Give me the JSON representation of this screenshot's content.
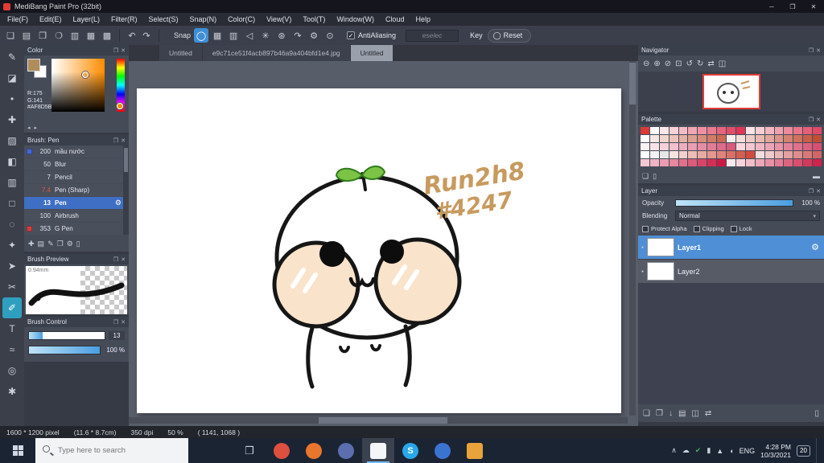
{
  "window": {
    "title": "MediBang Paint Pro (32bit)",
    "controls": {
      "minimize": "─",
      "maximize": "❐",
      "close": "✕"
    }
  },
  "menu_bar": [
    "File(F)",
    "Edit(E)",
    "Layer(L)",
    "Filter(R)",
    "Select(S)",
    "Snap(N)",
    "Color(C)",
    "View(V)",
    "Tool(T)",
    "Window(W)",
    "Cloud",
    "Help"
  ],
  "toolbar": {
    "file_icons": [
      {
        "name": "new-canvas-icon",
        "glyph": "❏"
      },
      {
        "name": "open-file-icon",
        "glyph": "▤"
      },
      {
        "name": "save-icon",
        "glyph": "❐"
      },
      {
        "name": "comment-icon",
        "glyph": "❍"
      },
      {
        "name": "document-icon",
        "glyph": "▥"
      },
      {
        "name": "table-icon",
        "glyph": "▦"
      },
      {
        "name": "grid-icon",
        "glyph": "▩"
      }
    ],
    "undo": {
      "name": "undo-icon",
      "glyph": "↶"
    },
    "redo": {
      "name": "redo-icon",
      "glyph": "↷"
    },
    "snap_label": "Snap",
    "snap_icons": [
      {
        "name": "snap-off-icon",
        "glyph": "◯",
        "active": true
      },
      {
        "name": "snap-grid-icon",
        "glyph": "▦"
      },
      {
        "name": "snap-parallel-icon",
        "glyph": "▥"
      },
      {
        "name": "snap-cross-icon",
        "glyph": "◁"
      },
      {
        "name": "snap-vanishing-point-icon",
        "glyph": "✳"
      },
      {
        "name": "snap-radial-icon",
        "glyph": "⊛"
      },
      {
        "name": "snap-curve-icon",
        "glyph": "↷"
      },
      {
        "name": "snap-settings-icon",
        "glyph": "⚙"
      },
      {
        "name": "snap-detail-settings-icon",
        "glyph": "⊙"
      }
    ],
    "antialiasing_label": "AntiAliasing",
    "combo_text": "eselec",
    "key_label": "Key",
    "reset": {
      "label": "Reset",
      "glyph": "◯"
    }
  },
  "tabs": [
    {
      "label": "Untitled"
    },
    {
      "label": "e9c71ce51f4acb897b46a9a404bfd1e4.jpg"
    },
    {
      "label": "Untitled",
      "active": true
    }
  ],
  "left_tools": [
    {
      "name": "brush-tool",
      "glyph": "✎"
    },
    {
      "name": "eraser-tool",
      "glyph": "◪"
    },
    {
      "name": "dot-tool",
      "glyph": "•"
    },
    {
      "name": "move-tool",
      "glyph": "✚"
    },
    {
      "name": "fill-tool",
      "glyph": "▨"
    },
    {
      "name": "bucket-tool",
      "glyph": "◧"
    },
    {
      "name": "gradient-tool",
      "glyph": "▥"
    },
    {
      "name": "select-tool",
      "glyph": "□"
    },
    {
      "name": "lasso-tool",
      "glyph": "◌"
    },
    {
      "name": "magic-wand-tool",
      "glyph": "✦"
    },
    {
      "name": "operation-tool",
      "glyph": "➤"
    },
    {
      "name": "divide-tool",
      "glyph": "✂"
    },
    {
      "name": "select-pen-tool",
      "glyph": "✐",
      "active": true
    },
    {
      "name": "text-tool",
      "glyph": "T"
    },
    {
      "name": "curve-tool",
      "glyph": "≈"
    },
    {
      "name": "eyedropper-tool",
      "glyph": "◎"
    },
    {
      "name": "hand-tool",
      "glyph": "✱"
    }
  ],
  "panel_icons": {
    "float": "❐",
    "close": "✕"
  },
  "color_panel": {
    "title": "Color",
    "r": "R:175",
    "g": "G:141",
    "hex": "#AF8D5B"
  },
  "brush_panel": {
    "title": "Brush: Pen",
    "items": [
      {
        "size": "200",
        "name": "mầu nước",
        "swatch": "#4668d8"
      },
      {
        "size": "50",
        "name": "Blur"
      },
      {
        "size": "7",
        "name": "Pencil"
      },
      {
        "size": "7.4",
        "name": "Pen (Sharp)",
        "size_color": "#e05a3a"
      },
      {
        "size": "13",
        "name": "Pen",
        "selected": true
      },
      {
        "size": "100",
        "name": "Airbrush"
      },
      {
        "size": "353",
        "name": "G Pen",
        "swatch": "#d04040"
      }
    ],
    "tool_icons": [
      {
        "name": "add-brush-icon",
        "glyph": "✚"
      },
      {
        "name": "brush-folder-icon",
        "glyph": "▤"
      },
      {
        "name": "edit-brush-icon",
        "glyph": "✎"
      },
      {
        "name": "duplicate-brush-icon",
        "glyph": "❐"
      },
      {
        "name": "brush-menu-icon",
        "glyph": "⚙"
      },
      {
        "name": "delete-brush-icon",
        "glyph": "▯"
      }
    ]
  },
  "brush_preview": {
    "title": "Brush Preview",
    "size_label": "0.94mm"
  },
  "brush_control": {
    "title": "Brush Control",
    "size_value": "13",
    "opacity_value": "100 %"
  },
  "canvas": {
    "annotation_line1": "Run2h8",
    "annotation_line2": "#4247"
  },
  "navigator": {
    "title": "Navigator",
    "icons": [
      {
        "name": "zoom-out-icon",
        "glyph": "⊖"
      },
      {
        "name": "zoom-in-icon",
        "glyph": "⊕"
      },
      {
        "name": "zoom-reset-icon",
        "glyph": "⊘"
      },
      {
        "name": "fit-window-icon",
        "glyph": "⊡"
      },
      {
        "name": "rotate-left-icon",
        "glyph": "↺"
      },
      {
        "name": "rotate-right-icon",
        "glyph": "↻"
      },
      {
        "name": "reset-rotation-icon",
        "glyph": "⇄"
      },
      {
        "name": "spread-view-icon",
        "glyph": "◫"
      }
    ]
  },
  "palette": {
    "title": "Palette",
    "colors": [
      [
        "#d93a35",
        "#ffffff",
        "#fce8ea",
        "#f9d2d8",
        "#f5bcc5",
        "#f1a6b3",
        "#ee90a1",
        "#ea7a8e",
        "#e6647c",
        "#e24e69",
        "#de3857",
        "#fbe3e6",
        "#f8cdd3",
        "#f4b7c1",
        "#f0a1ae",
        "#ec8b9c",
        "#e97589",
        "#e55f77",
        "#e14964"
      ],
      [
        "#ffffff",
        "#f6e7e3",
        "#f0d5ce",
        "#eac3ba",
        "#e4b1a5",
        "#dd9f91",
        "#d78d7c",
        "#d17b68",
        "#cb6953",
        "#f9efee",
        "#f3ddd9",
        "#edcbc5",
        "#e7b9b0",
        "#e1a79c",
        "#da9587",
        "#d48373",
        "#ce715e",
        "#c85f4a",
        "#c24d35"
      ],
      [
        "#fdf3f5",
        "#f9e2e8",
        "#f5d1da",
        "#f1c0cd",
        "#edafbf",
        "#e99eb2",
        "#e58da4",
        "#e17c97",
        "#dd6b89",
        "#d95a7c",
        "#f7d8de",
        "#f3c7d1",
        "#efb6c3",
        "#eba5b6",
        "#e794a8",
        "#e3839b",
        "#df728d",
        "#db6180",
        "#d75072"
      ],
      [
        "#ffffff",
        "#f2f2f2",
        "#e6e6e6",
        "#f8e3e1",
        "#f3d0cd",
        "#eebdb8",
        "#e9aaa4",
        "#e49790",
        "#df847b",
        "#da7167",
        "#d55e52",
        "#d04b3e",
        "#f6dddd",
        "#f0c9c9",
        "#eab5b5",
        "#e4a1a1",
        "#de8d8d",
        "#d87979",
        "#d26565"
      ],
      [
        "#f4c9d4",
        "#efb3c2",
        "#ea9db0",
        "#e5879e",
        "#e0718c",
        "#db5b7a",
        "#d64568",
        "#d12f56",
        "#cc1944",
        "#fbe9ed",
        "#f6d3db",
        "#f1bdc9",
        "#eca7b7",
        "#e791a5",
        "#e27b93",
        "#dd6581",
        "#d84f6f",
        "#d3395d",
        "#ce234b"
      ]
    ],
    "icons": [
      {
        "name": "add-palette-color-icon",
        "glyph": "❏"
      },
      {
        "name": "delete-palette-color-icon",
        "glyph": "▯"
      },
      {
        "name": "palette-menu-icon",
        "glyph": "▬"
      }
    ]
  },
  "layer_panel": {
    "title": "Layer",
    "opacity_label": "Opacity",
    "opacity_value": "100 %",
    "blending_label": "Blending",
    "blending_value": "Normal",
    "checkboxes": [
      "Protect Alpha",
      "Clipping",
      "Lock"
    ],
    "layers": [
      {
        "name": "Layer1",
        "selected": true
      },
      {
        "name": "Layer2"
      }
    ],
    "bottom_icons": [
      {
        "name": "add-layer-icon",
        "glyph": "❏"
      },
      {
        "name": "duplicate-layer-icon",
        "glyph": "❐"
      },
      {
        "name": "merge-layer-icon",
        "glyph": "↓"
      },
      {
        "name": "layer-folder-icon",
        "glyph": "▤"
      },
      {
        "name": "material-icon",
        "glyph": "◫"
      },
      {
        "name": "transform-icon",
        "glyph": "⇄"
      },
      {
        "name": "delete-layer-icon",
        "glyph": "▯"
      }
    ]
  },
  "status_bar": {
    "segments": [
      "1600 * 1200 pixel",
      "(11.6 * 8.7cm)",
      "350 dpi",
      "50 %",
      "( 1141, 1068 )"
    ]
  },
  "taskbar": {
    "search_placeholder": "Type here to search",
    "apps": [
      {
        "name": "task-view-icon",
        "glyph": "❐"
      },
      {
        "name": "chrome-icon",
        "color": "#dd4f3e"
      },
      {
        "name": "firefox-icon",
        "color": "#e8762c"
      },
      {
        "name": "discord-icon",
        "color": "#5b6eae"
      },
      {
        "name": "medibang-icon",
        "color": "#f5f6f8",
        "shape": "square",
        "active": true
      },
      {
        "name": "skype-icon",
        "color": "#28a8ea",
        "letter": "S"
      },
      {
        "name": "mail-icon",
        "color": "#3b73d1"
      },
      {
        "name": "folder-icon",
        "color": "#e9a33b",
        "shape": "square"
      }
    ],
    "tray_icons": [
      {
        "name": "tray-expand-icon",
        "glyph": "∧"
      },
      {
        "name": "onedrive-icon",
        "glyph": "☁"
      },
      {
        "name": "security-icon",
        "glyph": "✔",
        "color": "#4cae5c"
      },
      {
        "name": "battery-icon",
        "glyph": "▮"
      },
      {
        "name": "network-icon",
        "glyph": "▲"
      },
      {
        "name": "volume-icon",
        "glyph": "◖"
      }
    ],
    "language": "ENG",
    "time": "4:28 PM",
    "date": "10/3/2021",
    "badge": "20"
  },
  "colors": {
    "accent_blue": "#3f8fd6",
    "selected_layer": "#4e8fd6",
    "tool_active": "#2f9fc0",
    "canvas_annotation": "#c79a5e",
    "foreground_color": "#AF8D5B"
  }
}
